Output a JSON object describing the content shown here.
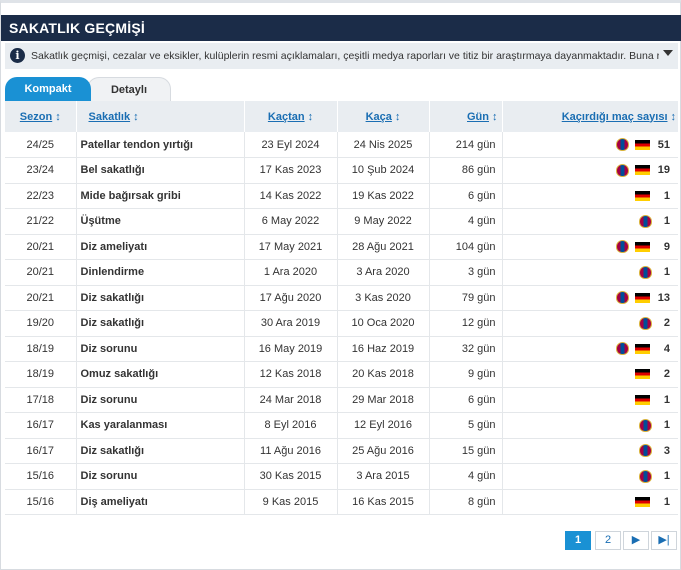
{
  "header": {
    "title": "SAKATLIK GEÇMİŞİ"
  },
  "info": {
    "text": "Sakatlık geçmişi, cezalar ve eksikler, kulüplerin resmi açıklamaları, çeşitli medya raporları ve titiz bir araştırmaya dayanmaktadır. Buna rağmen"
  },
  "tabs": [
    {
      "label": "Kompakt",
      "active": true
    },
    {
      "label": "Detaylı",
      "active": false
    }
  ],
  "table": {
    "columns": [
      "Sezon",
      "Sakatlık",
      "Kaçtan",
      "Kaça",
      "Gün",
      "Kaçırdığı maç sayısı"
    ],
    "rows": [
      {
        "season": "24/25",
        "injury": "Patellar tendon yırtığı",
        "from": "23 Eyl 2024",
        "until": "24 Nis 2025",
        "days": "214 gün",
        "club": true,
        "flag": true,
        "games": "51"
      },
      {
        "season": "23/24",
        "injury": "Bel sakatlığı",
        "from": "17 Kas 2023",
        "until": "10 Şub 2024",
        "days": "86 gün",
        "club": true,
        "flag": true,
        "games": "19"
      },
      {
        "season": "22/23",
        "injury": "Mide bağırsak gribi",
        "from": "14 Kas 2022",
        "until": "19 Kas 2022",
        "days": "6 gün",
        "club": false,
        "flag": true,
        "games": "1"
      },
      {
        "season": "21/22",
        "injury": "Üşütme",
        "from": "6 May 2022",
        "until": "9 May 2022",
        "days": "4 gün",
        "club": true,
        "flag": false,
        "games": "1"
      },
      {
        "season": "20/21",
        "injury": "Diz ameliyatı",
        "from": "17 May 2021",
        "until": "28 Ağu 2021",
        "days": "104 gün",
        "club": true,
        "flag": true,
        "games": "9"
      },
      {
        "season": "20/21",
        "injury": "Dinlendirme",
        "from": "1 Ara 2020",
        "until": "3 Ara 2020",
        "days": "3 gün",
        "club": true,
        "flag": false,
        "games": "1"
      },
      {
        "season": "20/21",
        "injury": "Diz sakatlığı",
        "from": "17 Ağu 2020",
        "until": "3 Kas 2020",
        "days": "79 gün",
        "club": true,
        "flag": true,
        "games": "13"
      },
      {
        "season": "19/20",
        "injury": "Diz sakatlığı",
        "from": "30 Ara 2019",
        "until": "10 Oca 2020",
        "days": "12 gün",
        "club": true,
        "flag": false,
        "games": "2"
      },
      {
        "season": "18/19",
        "injury": "Diz sorunu",
        "from": "16 May 2019",
        "until": "16 Haz 2019",
        "days": "32 gün",
        "club": true,
        "flag": true,
        "games": "4"
      },
      {
        "season": "18/19",
        "injury": "Omuz sakatlığı",
        "from": "12 Kas 2018",
        "until": "20 Kas 2018",
        "days": "9 gün",
        "club": false,
        "flag": true,
        "games": "2"
      },
      {
        "season": "17/18",
        "injury": "Diz sorunu",
        "from": "24 Mar 2018",
        "until": "29 Mar 2018",
        "days": "6 gün",
        "club": false,
        "flag": true,
        "games": "1"
      },
      {
        "season": "16/17",
        "injury": "Kas yaralanması",
        "from": "8 Eyl 2016",
        "until": "12 Eyl 2016",
        "days": "5 gün",
        "club": true,
        "flag": false,
        "games": "1"
      },
      {
        "season": "16/17",
        "injury": "Diz sakatlığı",
        "from": "11 Ağu 2016",
        "until": "25 Ağu 2016",
        "days": "15 gün",
        "club": true,
        "flag": false,
        "games": "3"
      },
      {
        "season": "15/16",
        "injury": "Diz sorunu",
        "from": "30 Kas 2015",
        "until": "3 Ara 2015",
        "days": "4 gün",
        "club": true,
        "flag": false,
        "games": "1"
      },
      {
        "season": "15/16",
        "injury": "Diş ameliyatı",
        "from": "9 Kas 2015",
        "until": "16 Kas 2015",
        "days": "8 gün",
        "club": false,
        "flag": true,
        "games": "1"
      }
    ]
  },
  "pagination": {
    "pages": [
      "1",
      "2"
    ],
    "current": "1",
    "next": "▶",
    "last": "▶|"
  },
  "colors": {
    "header_bg": "#1b2c48",
    "accent": "#1a91d4",
    "link": "#1a6eb3"
  },
  "icons": {
    "club": "fc-barcelona-crest-icon",
    "flag": "germany-flag-icon",
    "info": "info-icon",
    "toggle": "chevron-down-icon"
  }
}
